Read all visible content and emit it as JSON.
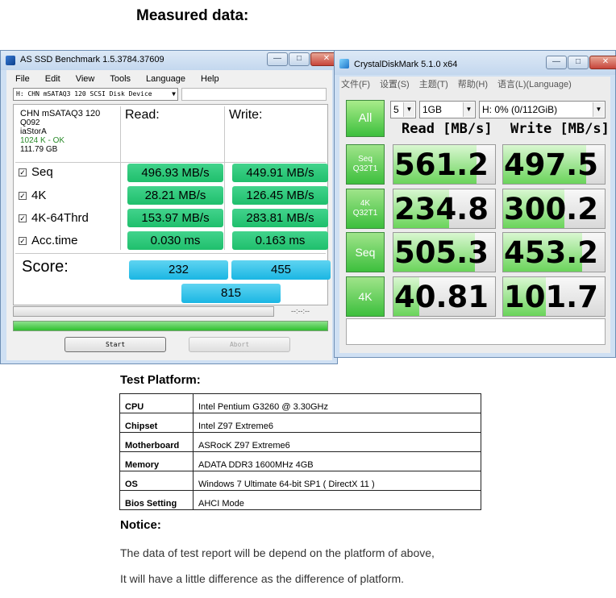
{
  "heading": "Measured data:",
  "asssd": {
    "title": "AS SSD Benchmark 1.5.3784.37609",
    "menu": [
      "File",
      "Edit",
      "View",
      "Tools",
      "Language",
      "Help"
    ],
    "drive_select": "H: CHN mSATAQ3 120 SCSI Disk Device",
    "info": {
      "model": "CHN mSATAQ3 120",
      "firmware": "Q092",
      "driver": "iaStorA",
      "align": "1024 K - OK",
      "size": "111.79 GB"
    },
    "read_header": "Read:",
    "write_header": "Write:",
    "rows": [
      {
        "label": "Seq",
        "read": "496.93 MB/s",
        "write": "449.91 MB/s"
      },
      {
        "label": "4K",
        "read": "28.21 MB/s",
        "write": "126.45 MB/s"
      },
      {
        "label": "4K-64Thrd",
        "read": "153.97 MB/s",
        "write": "283.81 MB/s"
      },
      {
        "label": "Acc.time",
        "read": "0.030 ms",
        "write": "0.163 ms"
      }
    ],
    "score_label": "Score:",
    "score_read": "232",
    "score_write": "455",
    "score_total": "815",
    "time": "--:--:--",
    "progress": 1.0,
    "start_label": "Start",
    "abort_label": "Abort",
    "colors": {
      "value_bg": "#2ec97a",
      "score_bg": "#2fbde7",
      "progress": "#36c236"
    }
  },
  "cdm": {
    "title": "CrystalDiskMark 5.1.0 x64",
    "menu": [
      "文件(F)",
      "设置(S)",
      "主题(T)",
      "帮助(H)",
      "语言(L)(Language)"
    ],
    "all_label": "All",
    "count": "5",
    "size": "1GB",
    "drive": "H: 0% (0/112GiB)",
    "read_header": "Read [MB/s]",
    "write_header": "Write [MB/s]",
    "rows": [
      {
        "label1": "Seq",
        "label2": "Q32T1",
        "read": "561.2",
        "write": "497.5",
        "read_fill": 0.82,
        "write_fill": 0.82
      },
      {
        "label1": "4K",
        "label2": "Q32T1",
        "read": "234.8",
        "write": "300.2",
        "read_fill": 0.55,
        "write_fill": 0.6
      },
      {
        "label1": "Seq",
        "label2": "",
        "read": "505.3",
        "write": "453.2",
        "read_fill": 0.8,
        "write_fill": 0.78
      },
      {
        "label1": "4K",
        "label2": "",
        "read": "40.81",
        "write": "101.7",
        "read_fill": 0.25,
        "write_fill": 0.42
      }
    ],
    "colors": {
      "bar": "#6ad45a",
      "label": "#3dbf3d"
    }
  },
  "platform": {
    "title": "Test Platform:",
    "rows": [
      {
        "key": "CPU",
        "value": "Intel Pentium G3260 @ 3.30GHz"
      },
      {
        "key": "Chipset",
        "value": "Intel Z97 Extreme6"
      },
      {
        "key": "Motherboard",
        "value": "ASRocK Z97 Extreme6"
      },
      {
        "key": "Memory",
        "value": "ADATA DDR3 1600MHz 4GB"
      },
      {
        "key": "OS",
        "value": "Windows 7 Ultimate 64-bit SP1 ( DirectX 11 )"
      },
      {
        "key": "Bios Setting",
        "value": "AHCI Mode"
      }
    ]
  },
  "notice": {
    "title": "Notice:",
    "line1": "The data of test report will be depend on the platform of above,",
    "line2": "It will have a little difference as the difference of platform."
  }
}
